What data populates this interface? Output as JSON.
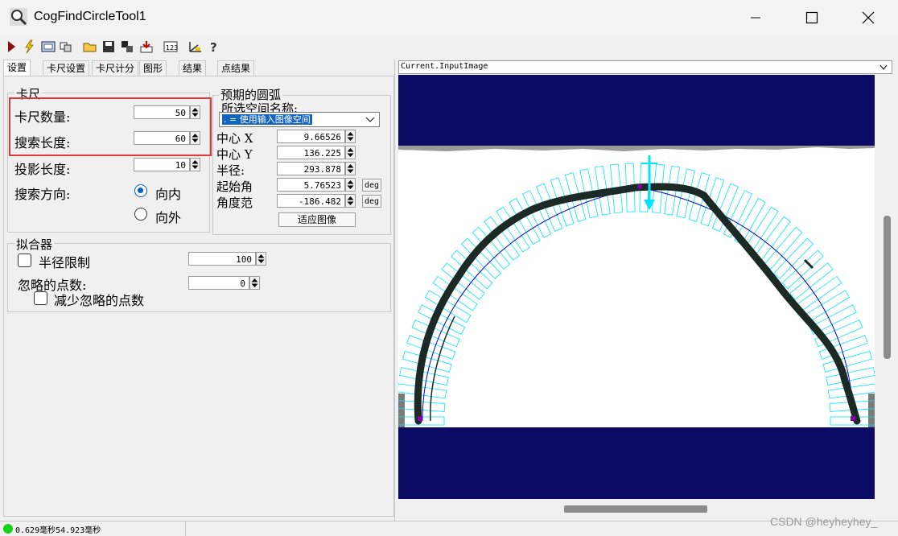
{
  "window": {
    "title": "CogFindCircleTool1"
  },
  "tabs": [
    "设置",
    "卡尺设置",
    "卡尺计分",
    "图形",
    "结果",
    "点结果"
  ],
  "caliper": {
    "group_label": "卡尺",
    "count_label": "卡尺数量:",
    "count_value": "50",
    "search_length_label": "搜索长度:",
    "search_length_value": "60",
    "projection_length_label": "投影长度:",
    "projection_length_value": "10",
    "direction_label": "搜索方向:",
    "dir_inward": "向内",
    "dir_outward": "向外",
    "direction_selected": "inward"
  },
  "arc": {
    "group_label": "预期的圆弧",
    "space_label": "所选空间名称:",
    "space_value": ". = 使用输入图像空间",
    "center_x_label": "中心 X",
    "center_x_value": "9.66526",
    "center_y_label": "中心 Y",
    "center_y_value": "136.225",
    "radius_label": "半径:",
    "radius_value": "293.878",
    "start_angle_label": "起始角",
    "start_angle_value": "5.76523",
    "angle_range_label": "角度范",
    "angle_range_value": "-186.482",
    "deg_label": "deg",
    "fit_button": "适应图像"
  },
  "fitter": {
    "group_label": "拟合器",
    "radius_limit_label": "半径限制",
    "radius_limit_value": "100",
    "ignore_points_label": "忽略的点数:",
    "ignore_points_value": "0",
    "reduce_ignore_label": "减少忽略的点数"
  },
  "display": {
    "image_selector": "Current.InputImage"
  },
  "status": {
    "timing": "0.629毫秒54.923毫秒"
  },
  "watermark": "CSDN @heyheyhey_",
  "colors": {
    "image_bg": "#0b0b66",
    "caliper": "#00e5ff",
    "arc": "#0000cc",
    "highlight": "#e0393a"
  }
}
